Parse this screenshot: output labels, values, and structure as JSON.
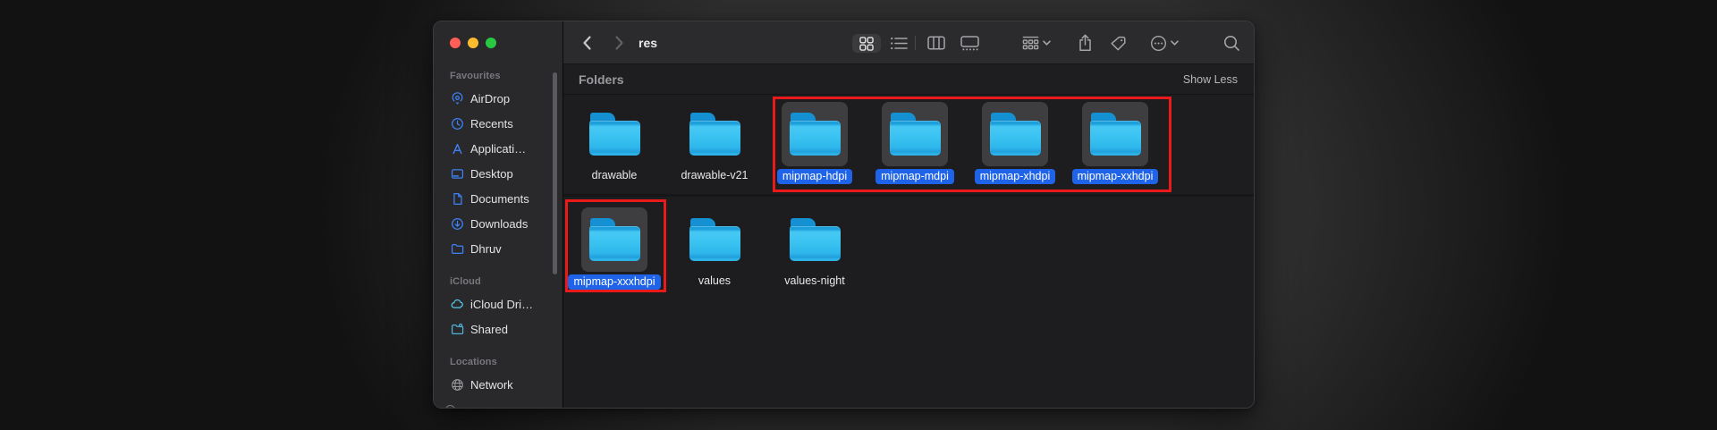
{
  "window": {
    "title": "res",
    "traffic_lights": [
      "close",
      "minimize",
      "zoom"
    ]
  },
  "toolbar": {
    "icons": [
      "back",
      "forward",
      "icon-view",
      "list-view",
      "column-view",
      "gallery-view",
      "group-by",
      "share",
      "tag",
      "more",
      "search"
    ],
    "selected_view": "icon-view"
  },
  "sidebar": {
    "sections": [
      {
        "label": "Favourites",
        "items": [
          {
            "label": "AirDrop",
            "icon": "airdrop-icon"
          },
          {
            "label": "Recents",
            "icon": "clock-icon"
          },
          {
            "label": "Applicati…",
            "icon": "applications-icon"
          },
          {
            "label": "Desktop",
            "icon": "desktop-icon"
          },
          {
            "label": "Documents",
            "icon": "document-icon"
          },
          {
            "label": "Downloads",
            "icon": "download-circle-icon"
          },
          {
            "label": "Dhruv",
            "icon": "folder-icon"
          }
        ]
      },
      {
        "label": "iCloud",
        "items": [
          {
            "label": "iCloud Dri…",
            "icon": "cloud-icon"
          },
          {
            "label": "Shared",
            "icon": "shared-folder-icon"
          }
        ]
      },
      {
        "label": "Locations",
        "items": [
          {
            "label": "Network",
            "icon": "globe-icon"
          }
        ]
      }
    ]
  },
  "content": {
    "section_title": "Folders",
    "show_less_label": "Show Less"
  },
  "folders": [
    {
      "name": "drawable",
      "selected": false
    },
    {
      "name": "drawable-v21",
      "selected": false
    },
    {
      "name": "mipmap-hdpi",
      "selected": true
    },
    {
      "name": "mipmap-mdpi",
      "selected": true
    },
    {
      "name": "mipmap-xhdpi",
      "selected": true
    },
    {
      "name": "mipmap-xxhdpi",
      "selected": true
    },
    {
      "name": "mipmap-xxxhdpi",
      "selected": true
    },
    {
      "name": "values",
      "selected": false
    },
    {
      "name": "values-night",
      "selected": false
    }
  ],
  "annotations": {
    "boxes": [
      {
        "name": "highlight-mipmap-row1",
        "around": [
          "mipmap-hdpi",
          "mipmap-mdpi",
          "mipmap-xhdpi",
          "mipmap-xxhdpi"
        ]
      },
      {
        "name": "highlight-mipmap-xxxhdpi",
        "around": [
          "mipmap-xxxhdpi"
        ]
      }
    ],
    "color": "#eb1a1a"
  },
  "colors": {
    "selection_pill_blue": "#1f63e8",
    "folder_blue": "#36bfef",
    "sidebar_accent_blue": "#3d82f7",
    "annotation_red": "#eb1a1a",
    "window_sidebar_bg": "#29292c",
    "toolbar_bg": "#2b2b2d",
    "content_bg": "#1d1d1f"
  }
}
